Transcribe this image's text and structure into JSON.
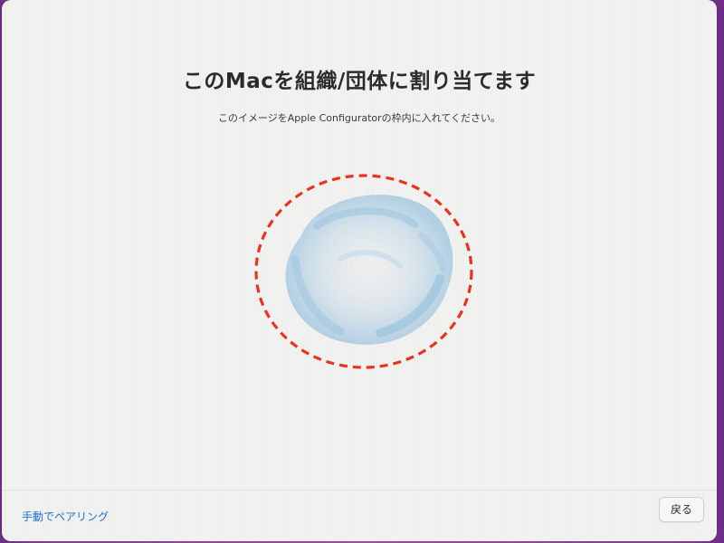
{
  "header": {
    "title": "このMacを組織/団体に割り当てます",
    "subtitle": "このイメージをApple Configuratorの枠内に入れてください。"
  },
  "scanner": {
    "pattern_name": "pairing-pattern",
    "frame_color": "#e8341c",
    "pattern_color": "#7fb9dc"
  },
  "footer": {
    "manual_pairing_label": "手動でペアリング",
    "back_label": "戻る"
  }
}
